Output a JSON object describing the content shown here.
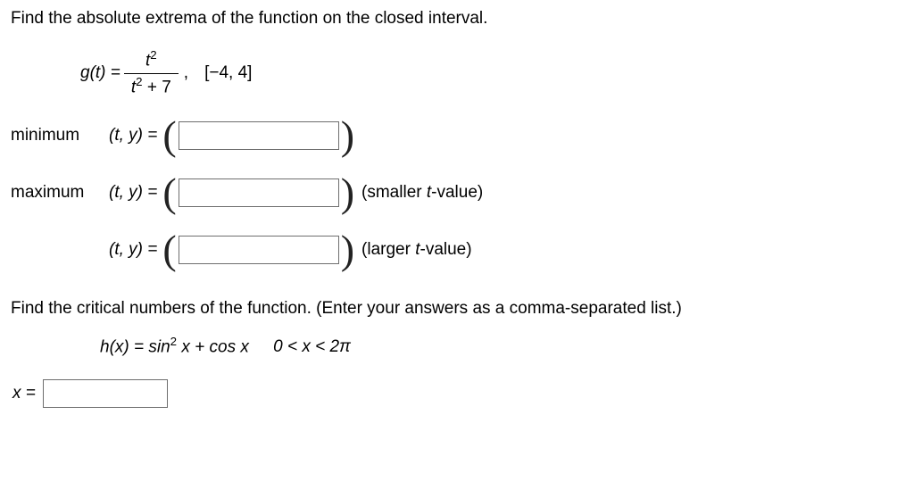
{
  "q1": {
    "prompt": "Find the absolute extrema of the function on the closed interval.",
    "func_lhs": "g(t) =",
    "numerator": "t",
    "denominator_left": "t",
    "denominator_right": " + 7",
    "interval": "[−4, 4]",
    "min_label": "minimum",
    "max_label": "maximum",
    "ty_label": "(t, y)  =",
    "smaller_note": "(smaller t-value)",
    "larger_note": "(larger t-value)"
  },
  "q2": {
    "prompt": "Find the critical numbers of the function. (Enter your answers as a comma-separated list.)",
    "func_lhs": "h(x) = sin",
    "func_mid": " x + cos x",
    "domain": "0 < x < 2π",
    "x_eq": "x ="
  }
}
